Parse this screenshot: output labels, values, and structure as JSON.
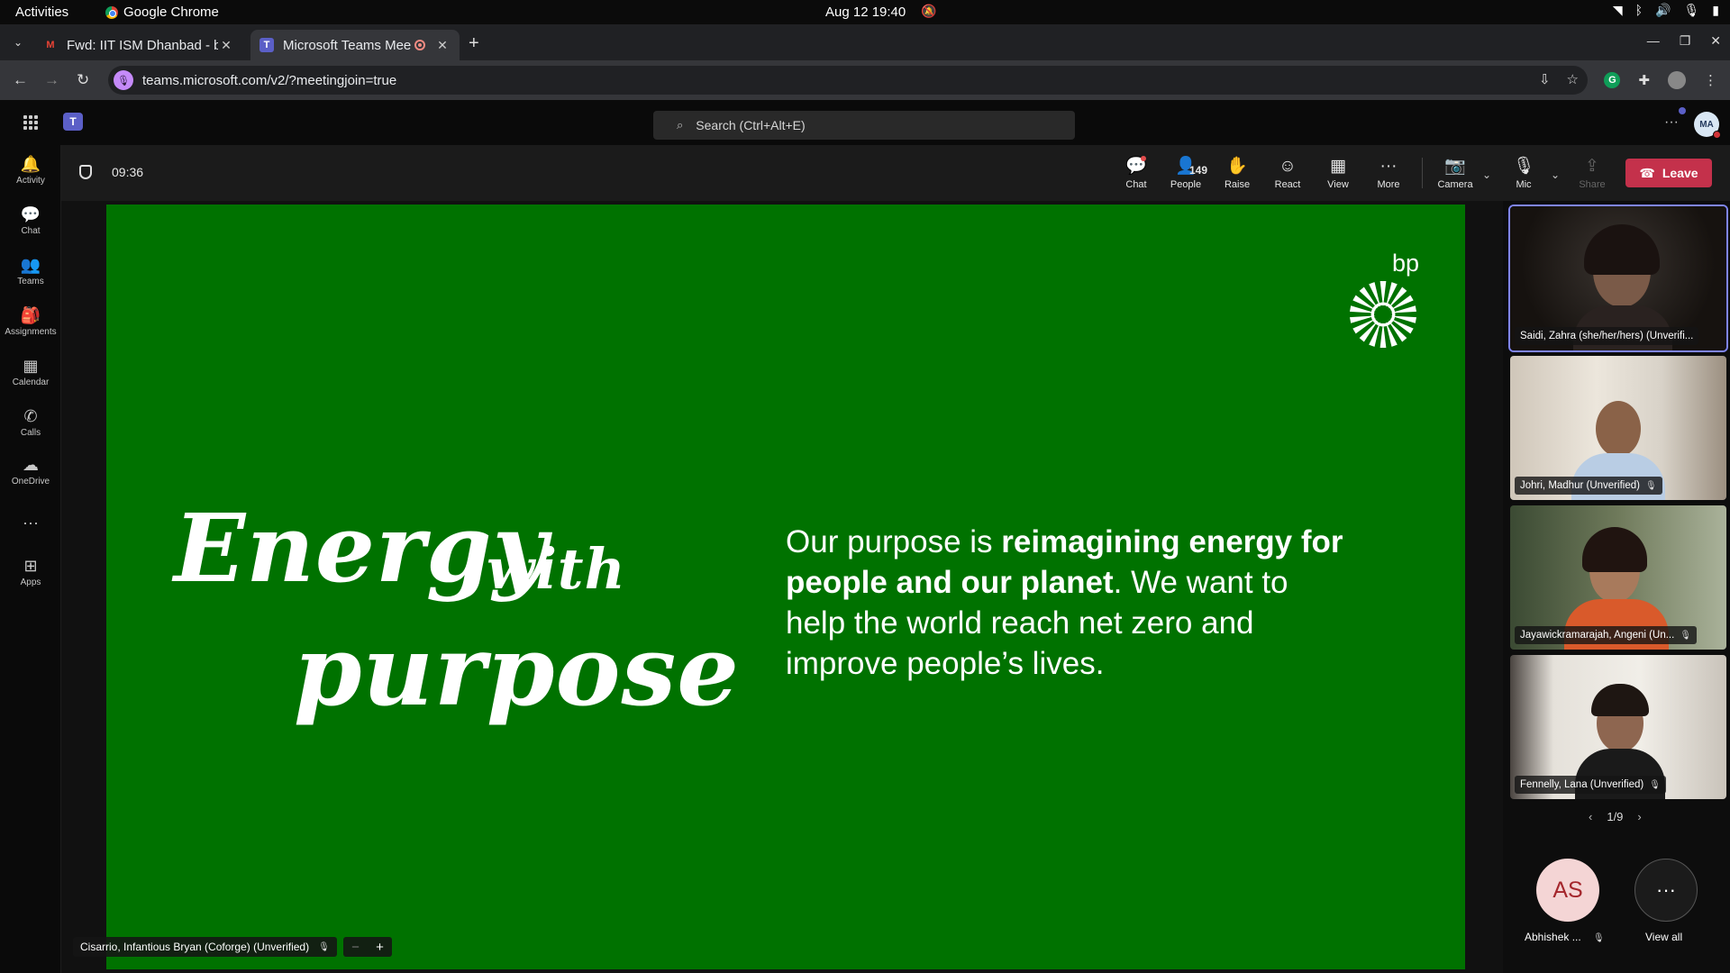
{
  "gnome": {
    "activities": "Activities",
    "app": "Google Chrome",
    "clock": "Aug 12  19:40"
  },
  "chrome": {
    "tabs": [
      {
        "title": "Fwd: IIT ISM Dhanbad - b",
        "favicon": "gmail-icon"
      },
      {
        "title": "Microsoft Teams Mee",
        "favicon": "teams-icon"
      }
    ],
    "url": "teams.microsoft.com/v2/?meetingjoin=true"
  },
  "teams": {
    "search_placeholder": "Search (Ctrl+Alt+E)",
    "user_initials": "MA",
    "rail": [
      {
        "label": "Activity",
        "icon": "bell-icon"
      },
      {
        "label": "Chat",
        "icon": "chat-icon"
      },
      {
        "label": "Teams",
        "icon": "teams-icon"
      },
      {
        "label": "Assignments",
        "icon": "assignments-icon"
      },
      {
        "label": "Calendar",
        "icon": "calendar-icon"
      },
      {
        "label": "Calls",
        "icon": "phone-icon"
      },
      {
        "label": "OneDrive",
        "icon": "cloud-icon"
      },
      {
        "label": "",
        "icon": "more-icon"
      },
      {
        "label": "Apps",
        "icon": "apps-icon"
      }
    ]
  },
  "meeting": {
    "timer": "09:36",
    "people_count": "149",
    "buttons": {
      "chat": "Chat",
      "people": "People",
      "raise": "Raise",
      "react": "React",
      "view": "View",
      "more": "More",
      "camera": "Camera",
      "mic": "Mic",
      "share": "Share",
      "leave": "Leave"
    },
    "presenter": "Cisarrio, Infantious Bryan (Coforge) (Unverified)"
  },
  "slide": {
    "logo_text": "bp",
    "script_line1": "Energy",
    "script_line2": "with",
    "script_line3": "purpose",
    "text_part1": "Our purpose is ",
    "text_bold1": "reimagining energy for people and our planet",
    "text_part2": ". We want to help the world reach net zero and improve people’s lives.",
    "bg_color": "#007200"
  },
  "gallery": {
    "participants": [
      {
        "name": "Saidi, Zahra (she/her/hers) (Unverifi...",
        "muted": false,
        "active": true
      },
      {
        "name": "Johri, Madhur (Unverified)",
        "muted": true,
        "active": false
      },
      {
        "name": "Jayawickramarajah, Angeni (Un...",
        "muted": true,
        "active": false
      },
      {
        "name": "Fennelly, Lana (Unverified)",
        "muted": true,
        "active": false
      }
    ],
    "page": "1/9",
    "extra_avatar_initials": "AS",
    "extra_avatar_name": "Abhishek ...",
    "view_all": "View all"
  }
}
